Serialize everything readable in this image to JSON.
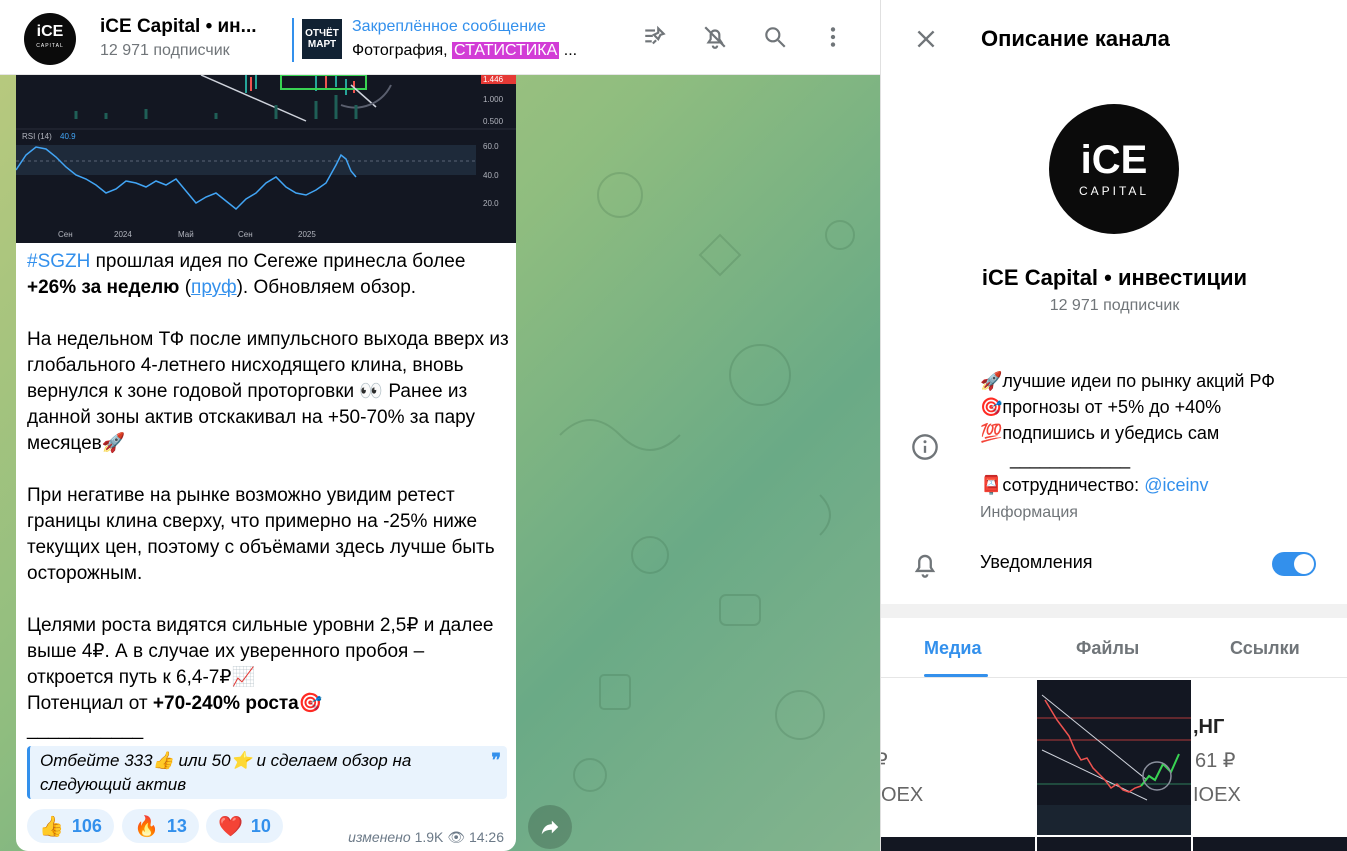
{
  "header": {
    "avatar_main": "iCE",
    "avatar_sub": "CAPITAL",
    "title": "iCE Capital • ин...",
    "subscribers": "12 971 подписчик",
    "pinned_label": "Закреплённое сообщение",
    "pinned_prefix": "Фотография, ",
    "pinned_glitch": "СТАТИСТИКА",
    "pinned_suffix": " ...",
    "pinned_thumb_line1": "ОТЧЁТ",
    "pinned_thumb_line2": "МАРТ",
    "icons": [
      "pinned-list-icon",
      "bell-off-icon",
      "search-icon",
      "more-vertical-icon"
    ]
  },
  "message": {
    "chart": {
      "price_labels": [
        "1.446",
        "1.000",
        "0.500"
      ],
      "rsi_label": "RSI (14)",
      "rsi_value": "40.9",
      "rsi_levels": [
        "60.0",
        "40.0",
        "20.0"
      ],
      "x_labels": [
        "Сен",
        "2024",
        "Май",
        "Сен",
        "2025"
      ]
    },
    "p1_tag": "#SGZH",
    "p1_text": " прошлая идея по Сегеже принесла более ",
    "p1_bold": "+26% за неделю",
    "p1_open": " (",
    "p1_link": "пруф",
    "p1_close": "). Обновляем обзор.",
    "p2": "На недельном ТФ после импульсного выхода вверх из глобального 4-летнего нисходящего клина, вновь вернулся к зоне годовой проторговки 👀 Ранее из данной зоны актив отскакивал на +50-70% за пару месяцев🚀",
    "p3": "При негативе на рынке возможно увидим ретест границы клина сверху, что примерно на -25% ниже текущих цен, поэтому с объёмами здесь лучше быть осторожным.",
    "p4_a": "Целями роста видятся сильные уровни 2,5₽ и далее выше 4₽. А в случае их уверенного пробоя – откроется путь к 6,4-7₽📈",
    "p4_b_pre": "Потенциал от ",
    "p4_b_bold": "+70-240% роста",
    "p4_b_emoji": "🎯",
    "divider": "___________",
    "quote": "Отбейте 333👍 или 50⭐ и сделаем обзор на следующий актив",
    "quote_mark": "❞",
    "reactions": [
      {
        "emoji": "👍",
        "count": "106"
      },
      {
        "emoji": "🔥",
        "count": "13"
      },
      {
        "emoji": "❤️",
        "count": "10"
      }
    ],
    "edited": "изменено",
    "views": "1.9K",
    "time": "14:26"
  },
  "panel": {
    "title": "Описание канала",
    "avatar_main": "iCE",
    "avatar_sub": "CAPITAL",
    "name": "iCE Capital • инвестиции",
    "subscribers": "12 971 подписчик",
    "desc_line1": "🚀лучшие идеи по рынку акций РФ",
    "desc_line2": "🎯прогнозы от +5% до +40%",
    "desc_line3": "💯подпишись и убедись сам",
    "desc_line4": "____________",
    "desc_line5_pre": "📮сотрудничество: ",
    "desc_link": "@iceinv",
    "desc_caption": "Информация",
    "notifications_label": "Уведомления",
    "notifications_on": true,
    "tabs": [
      "Медиа",
      "Файлы",
      "Ссылки"
    ],
    "media_left_price": "₽",
    "media_left_moex": "OEX",
    "media_right_title": ",НГ",
    "media_right_price": "61 ₽",
    "media_right_moex": "IOEX"
  },
  "colors": {
    "accent": "#3390ec",
    "chat_bg_start": "#b7c97e",
    "chat_bg_end": "#6aaa86",
    "toggle_on": "#3390ec"
  }
}
